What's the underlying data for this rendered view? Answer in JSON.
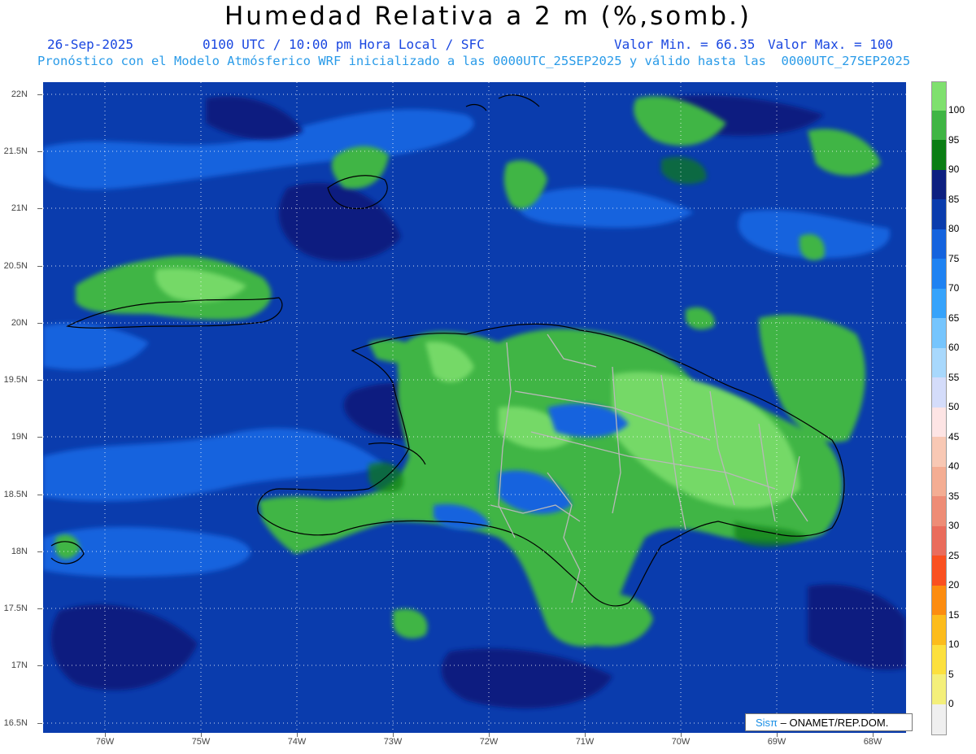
{
  "header": {
    "title": "Humedad Relativa a 2 m (%,somb.)",
    "date": "26-Sep-2025",
    "time": "0100 UTC / 10:00 pm Hora Local / SFC",
    "min": "Valor Min. = 66.35",
    "max": "Valor Max. = 100",
    "subtitle": "Pronóstico con el Modelo Atmósferico WRF inicializado a las 0000UTC_25SEP2025 y válido hasta las  0000UTC_27SEP2025"
  },
  "axes": {
    "y_labels": [
      "22N",
      "21.5N",
      "21N",
      "20.5N",
      "20N",
      "19.5N",
      "19N",
      "18.5N",
      "18N",
      "17.5N",
      "17N",
      "16.5N"
    ],
    "x_labels": [
      "76W",
      "75W",
      "74W",
      "73W",
      "72W",
      "71W",
      "70W",
      "69W",
      "68W"
    ]
  },
  "colorbar": {
    "labels": [
      "100",
      "95",
      "90",
      "85",
      "80",
      "75",
      "70",
      "65",
      "60",
      "55",
      "50",
      "45",
      "40",
      "35",
      "30",
      "25",
      "20",
      "15",
      "10",
      "5",
      "0"
    ],
    "colors": [
      "#7fe06e",
      "#3fb544",
      "#0a7d14",
      "#0d1f80",
      "#0a3cad",
      "#1463de",
      "#1e82f2",
      "#36a3fb",
      "#76c5fd",
      "#a8d8fc",
      "#d4dcfa",
      "#fde4e4",
      "#f8c8b4",
      "#f4ad93",
      "#ee8c76",
      "#ea6c5c",
      "#fa5020",
      "#fc8c10",
      "#fcbc1c",
      "#fce03e",
      "#f4ef7a",
      "#fcfca8",
      "#efefef"
    ]
  },
  "credit": {
    "logo": "Sisπ",
    "text": "– ONAMET/REP.DOM."
  }
}
